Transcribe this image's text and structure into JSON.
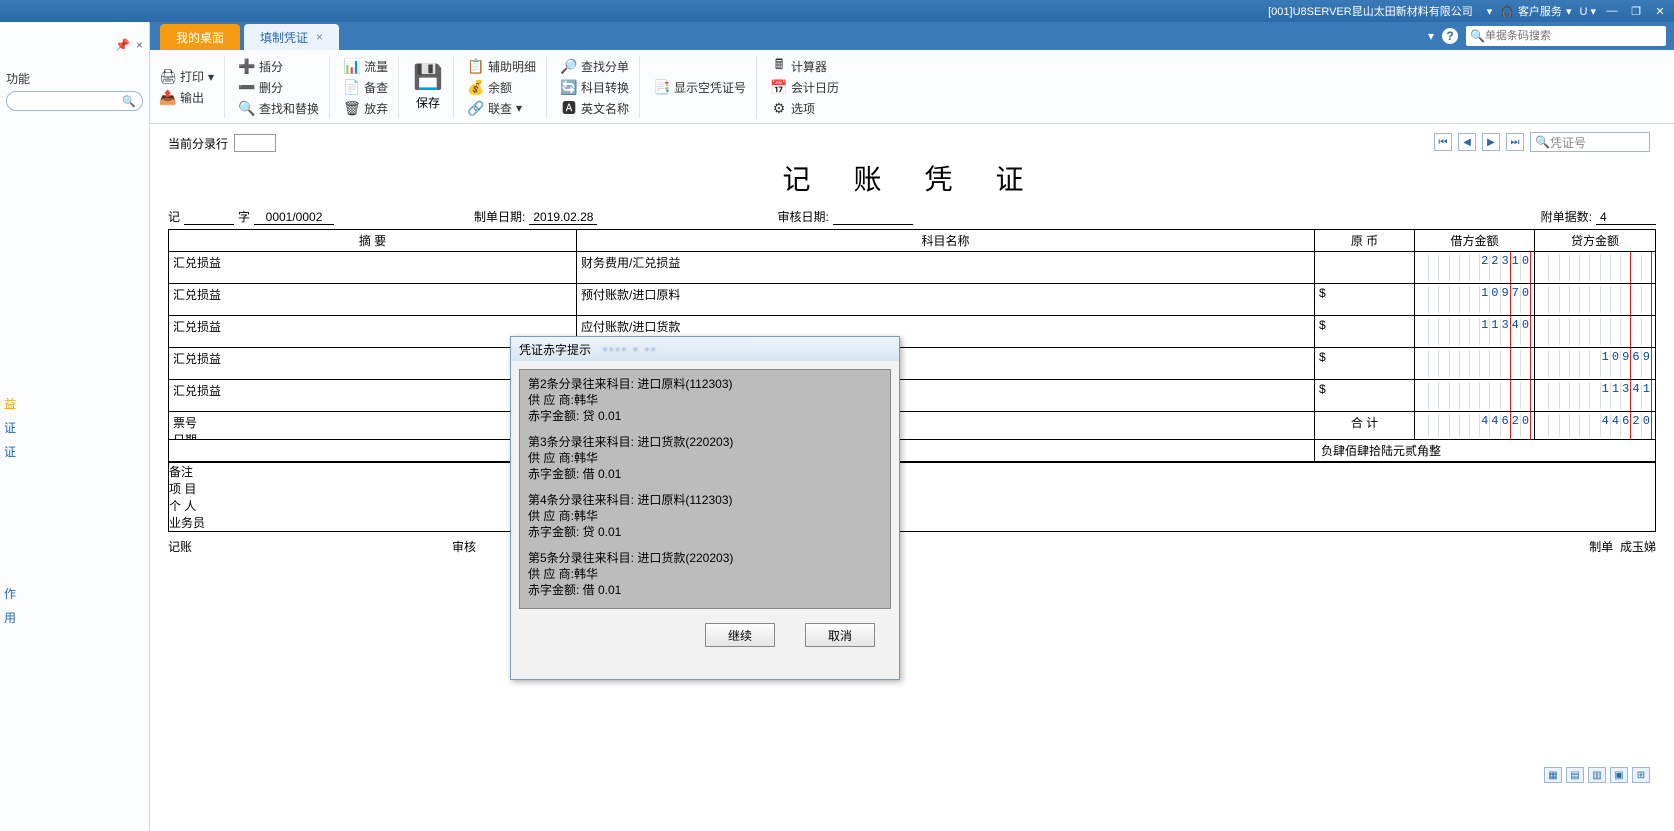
{
  "titlebar": {
    "company": "[001]U8SERVER昆山太田新材料有限公司",
    "service": "客户服务",
    "u_label": "U"
  },
  "tabs": {
    "home": "我的桌面",
    "voucher": "填制凭证",
    "search_placeholder": "单据条码搜索"
  },
  "leftpanel": {
    "func_label": "功能",
    "links_mid": [
      "益",
      "证",
      "证"
    ],
    "links_low": [
      "作",
      "用"
    ]
  },
  "ribbon": {
    "print": "打印",
    "export": "输出",
    "insert_row": "插分",
    "delete_row": "删分",
    "find_replace": "查找和替换",
    "flow": "流量",
    "recheck": "备查",
    "abandon": "放弃",
    "save": "保存",
    "aux_detail": "辅助明细",
    "balance": "余额",
    "joint_search": "联查",
    "find_entry": "查找分单",
    "subj_convert": "科目转换",
    "en_name": "英文名称",
    "show_blank": "显示空凭证号",
    "calculator": "计算器",
    "acct_calendar": "会计日历",
    "options": "选项"
  },
  "voucher": {
    "cur_row_label": "当前分录行",
    "title": "记 账 凭 证",
    "ji": "记",
    "zi": "字",
    "seq": "0001/0002",
    "makedate_label": "制单日期:",
    "makedate": "2019.02.28",
    "auditdate_label": "审核日期:",
    "attach_label": "附单据数:",
    "attach_count": "4",
    "pager_placeholder": "凭证号",
    "headers": {
      "summary": "摘 要",
      "subject": "科目名称",
      "currency": "原 币",
      "debit": "借方金额",
      "credit": "贷方金额"
    },
    "rows": [
      {
        "summary": "汇兑损益",
        "subject": "财务费用/汇兑损益",
        "currency": "",
        "debit": "22310",
        "credit": ""
      },
      {
        "summary": "汇兑损益",
        "subject": "预付账款/进口原料",
        "currency": "$",
        "debit": "10970",
        "credit": ""
      },
      {
        "summary": "汇兑损益",
        "subject": "应付账款/进口货款",
        "currency": "$",
        "debit": "11340",
        "credit": ""
      },
      {
        "summary": "汇兑损益",
        "subject": "",
        "currency": "$",
        "debit": "",
        "credit": "10969"
      },
      {
        "summary": "汇兑损益",
        "subject": "",
        "currency": "$",
        "debit": "",
        "credit": "11341"
      }
    ],
    "ticket_line1": "票号",
    "ticket_line2": "日期",
    "total_label": "合 计",
    "total_debit": "44620",
    "total_credit": "44620",
    "cn_total": "负肆佰肆拾陆元贰角整",
    "remark_label": "备注",
    "remark_items": [
      "项 目",
      "个 人",
      "业务员"
    ],
    "footer": {
      "post": "记账",
      "audit": "审核",
      "make": "制单",
      "maker": "成玉娣"
    }
  },
  "dialog": {
    "title": "凭证赤字提示",
    "entries": [
      "第2条分录往来科目: 进口原料(112303)\n供 应 商:韩华\n赤字金额: 贷 0.01",
      "第3条分录往来科目: 进口货款(220203)\n供 应 商:韩华\n赤字金额: 借 0.01",
      "第4条分录往来科目: 进口原料(112303)\n供 应 商:韩华\n赤字金额: 贷 0.01",
      "第5条分录往来科目: 进口货款(220203)\n供 应 商:韩华\n赤字金额: 借 0.01"
    ],
    "continue": "继续",
    "cancel": "取消"
  }
}
